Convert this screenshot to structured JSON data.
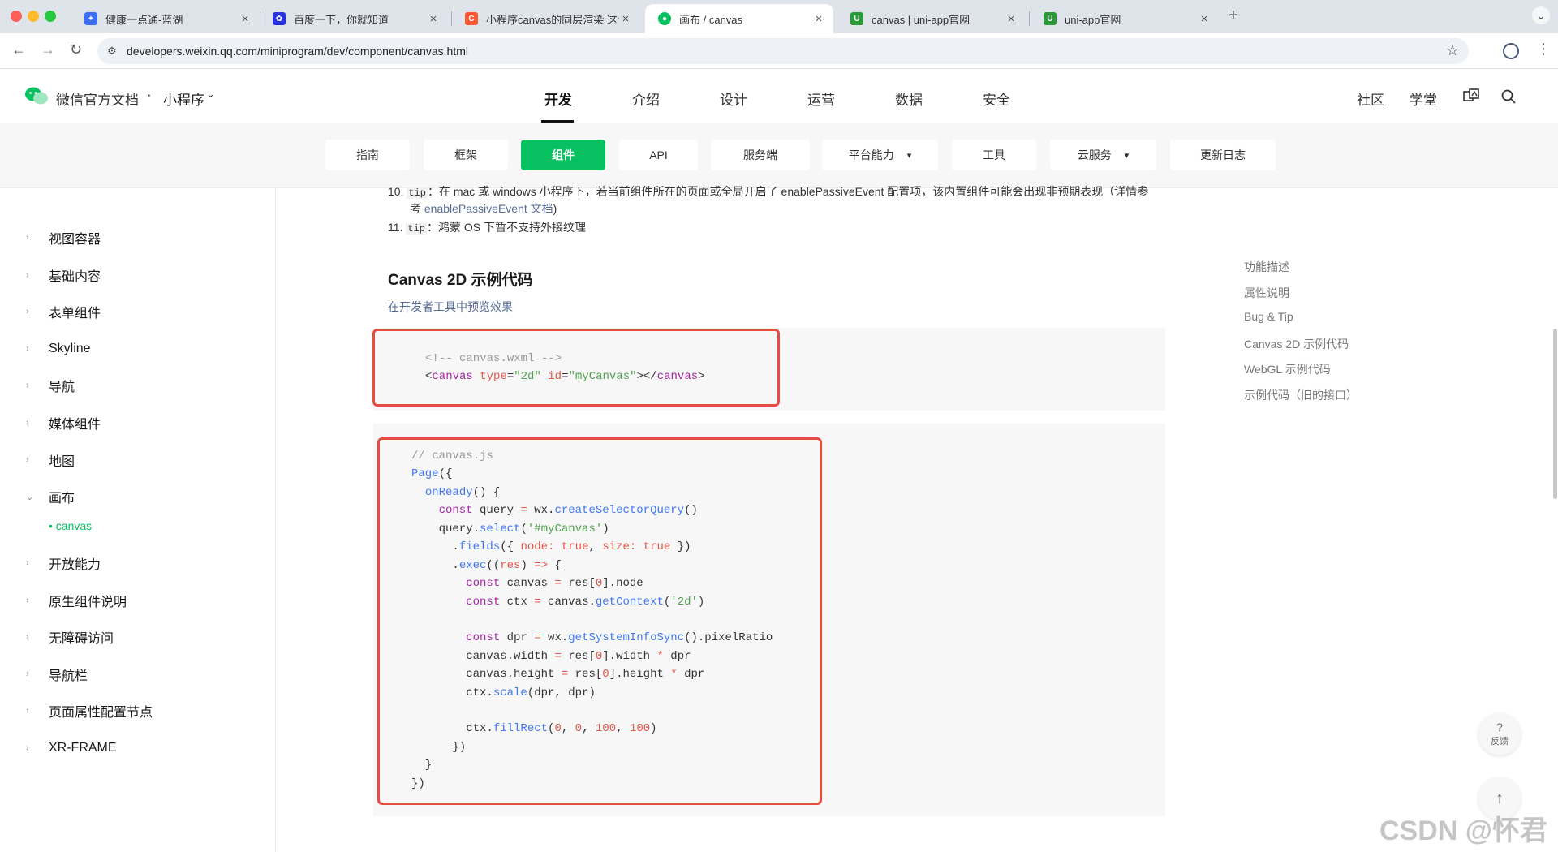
{
  "browser": {
    "tabs": [
      {
        "title": "健康一点通-蓝湖",
        "fav_color": "#3b6cf6",
        "fav_glyph": "✦"
      },
      {
        "title": "百度一下，你就知道",
        "fav_color": "#2932e1",
        "fav_glyph": "✿"
      },
      {
        "title": "小程序canvas的同层渲染 这个",
        "fav_color": "#fc5531",
        "fav_glyph": "C"
      },
      {
        "title": "画布 / canvas",
        "fav_color": "#07c160",
        "fav_glyph": "●"
      },
      {
        "title": "canvas | uni-app官网",
        "fav_color": "#2b9939",
        "fav_glyph": "U"
      },
      {
        "title": "uni-app官网",
        "fav_color": "#2b9939",
        "fav_glyph": "U"
      }
    ],
    "url": "developers.weixin.qq.com/miniprogram/dev/component/canvas.html"
  },
  "header": {
    "logo_text": "微信官方文档",
    "separator": "·",
    "product": "小程序",
    "nav": [
      "开发",
      "介绍",
      "设计",
      "运营",
      "数据",
      "安全"
    ],
    "right": [
      "社区",
      "学堂"
    ]
  },
  "subnav": [
    "指南",
    "框架",
    "组件",
    "API",
    "服务端",
    "平台能力",
    "工具",
    "云服务",
    "更新日志"
  ],
  "sidebar": {
    "items": [
      "视图容器",
      "基础内容",
      "表单组件",
      "Skyline",
      "导航",
      "媒体组件",
      "地图",
      "画布",
      "开放能力",
      "原生组件说明",
      "无障碍访问",
      "导航栏",
      "页面属性配置节点",
      "XR-FRAME"
    ],
    "sub_item": "canvas"
  },
  "content": {
    "item10_num": "10.",
    "item10_code": "tip",
    "item10_text": "：在 mac 或 windows 小程序下，若当前组件所在的页面或全局开启了 enablePassiveEvent 配置项，该内置组件可能会出现非预期表现（详情参",
    "item10_text2": "考 ",
    "item10_link": "enablePassiveEvent 文档",
    "item10_close": ")",
    "item11_num": "11.",
    "item11_code": "tip",
    "item11_text": "：鸿蒙 OS 下暂不支持外接纹理",
    "heading": "Canvas 2D 示例代码",
    "preview_link": "在开发者工具中预览效果"
  },
  "toc": [
    "功能描述",
    "属性说明",
    "Bug & Tip",
    "Canvas 2D 示例代码",
    "WebGL 示例代码",
    "示例代码（旧的接口）"
  ],
  "float": {
    "feedback_label": "反馈",
    "feedback_glyph": "?",
    "top_glyph": "↑"
  },
  "watermark": "CSDN @怀君"
}
